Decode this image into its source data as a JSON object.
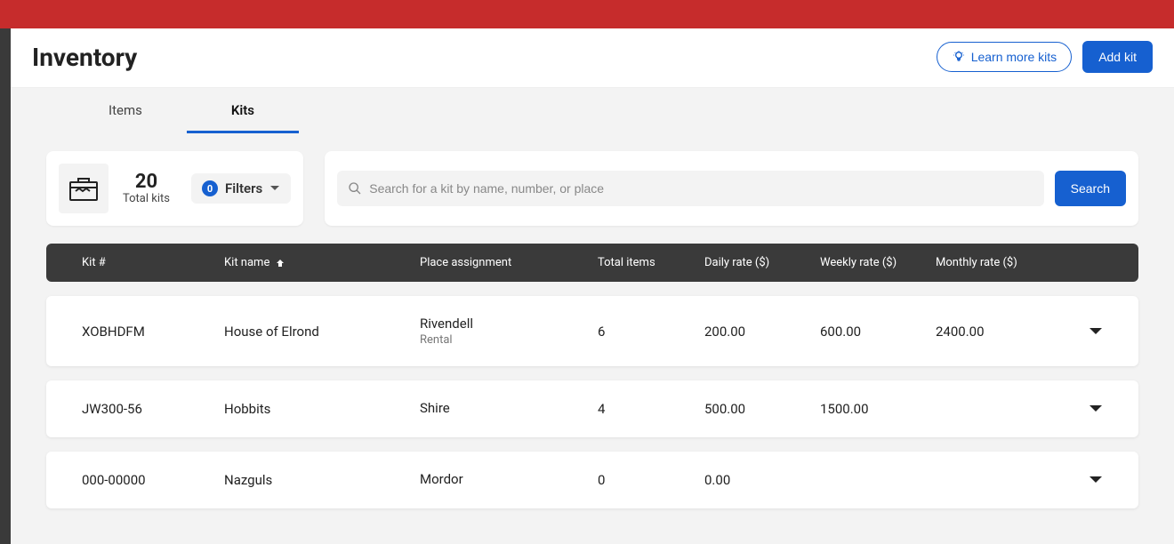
{
  "header": {
    "title": "Inventory",
    "learn_more_label": "Learn more kits",
    "add_kit_label": "Add kit"
  },
  "tabs": {
    "items_label": "Items",
    "kits_label": "Kits",
    "active": "Kits"
  },
  "summary": {
    "count": "20",
    "label": "Total kits",
    "filters_label": "Filters",
    "filters_count": "0"
  },
  "search": {
    "placeholder": "Search for a kit by name, number, or place",
    "button_label": "Search"
  },
  "table": {
    "columns": {
      "kit_number": "Kit #",
      "kit_name": "Kit name",
      "place": "Place assignment",
      "total_items": "Total items",
      "daily_rate": "Daily rate ($)",
      "weekly_rate": "Weekly rate ($)",
      "monthly_rate": "Monthly rate ($)"
    },
    "rows": [
      {
        "kit_number": "XOBHDFM",
        "kit_name": "House of Elrond",
        "place": "Rivendell",
        "place_sub": "Rental",
        "total_items": "6",
        "daily": "200.00",
        "weekly": "600.00",
        "monthly": "2400.00"
      },
      {
        "kit_number": "JW300-56",
        "kit_name": "Hobbits",
        "place": "Shire",
        "place_sub": "",
        "total_items": "4",
        "daily": "500.00",
        "weekly": "1500.00",
        "monthly": ""
      },
      {
        "kit_number": "000-00000",
        "kit_name": "Nazguls",
        "place": "Mordor",
        "place_sub": "",
        "total_items": "0",
        "daily": "0.00",
        "weekly": "",
        "monthly": ""
      }
    ]
  }
}
